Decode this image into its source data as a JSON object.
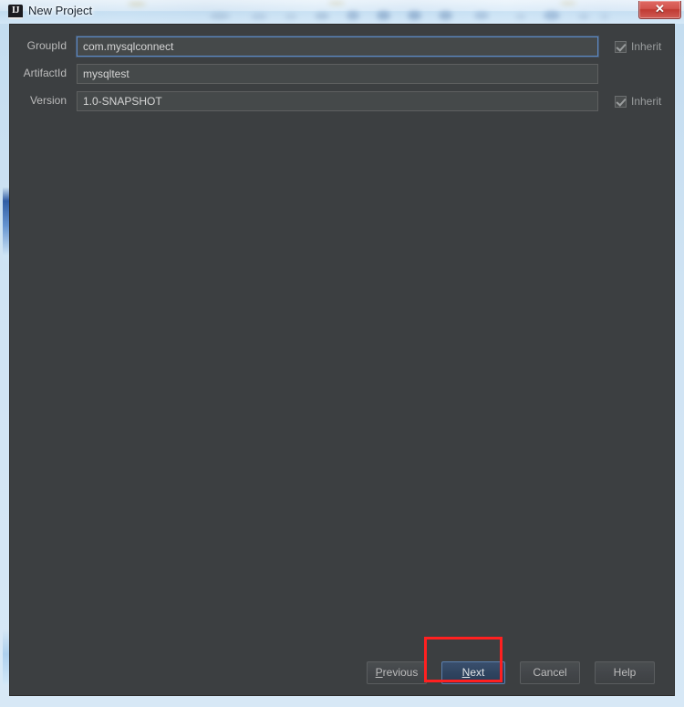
{
  "window": {
    "title": "New Project",
    "app_icon": "IJ",
    "close_label": "✕"
  },
  "form": {
    "rows": [
      {
        "label": "GroupId",
        "value": "com.mysqlconnect",
        "focused": true,
        "inherit": null
      },
      {
        "label": "ArtifactId",
        "value": "mysqltest",
        "focused": false,
        "inherit": null
      },
      {
        "label": "Version",
        "value": "1.0-SNAPSHOT",
        "focused": false,
        "inherit": null
      }
    ],
    "inherit_label": "Inherit",
    "inherit_checked": true
  },
  "buttons": {
    "previous": {
      "pre": "",
      "mnemonic": "P",
      "post": "revious"
    },
    "next": {
      "pre": "",
      "mnemonic": "N",
      "post": "ext"
    },
    "cancel": {
      "pre": "Cancel",
      "mnemonic": "",
      "post": ""
    },
    "help": {
      "pre": "Help",
      "mnemonic": "",
      "post": ""
    }
  },
  "colors": {
    "dialog_bg": "#3c3f41",
    "field_bg": "#45494a",
    "focus_border": "#5d89c4",
    "primary_button": "#2f4460",
    "annotation": "#ff2020",
    "close_button": "#c03a33"
  }
}
